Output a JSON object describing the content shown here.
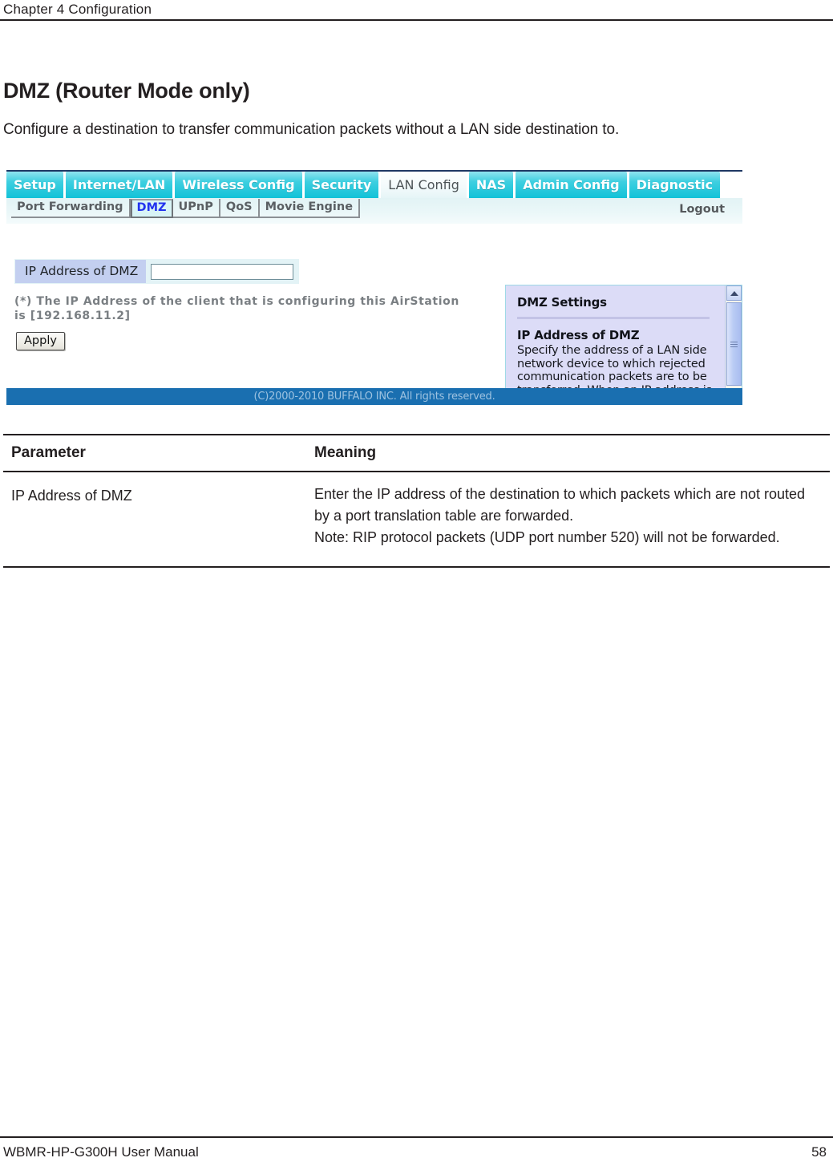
{
  "page": {
    "running_head": "Chapter 4  Configuration",
    "title": "DMZ (Router Mode only)",
    "subtitle": "Configure a destination to transfer communication packets without a LAN side destination to.",
    "footer_left": "WBMR-HP-G300H User Manual",
    "footer_page": "58"
  },
  "screenshot": {
    "tabs": [
      {
        "label": "Setup",
        "active": false
      },
      {
        "label": "Internet/LAN",
        "active": false
      },
      {
        "label": "Wireless Config",
        "active": false
      },
      {
        "label": "Security",
        "active": false
      },
      {
        "label": "LAN Config",
        "active": true
      },
      {
        "label": "NAS",
        "active": false
      },
      {
        "label": "Admin Config",
        "active": false
      },
      {
        "label": "Diagnostic",
        "active": false
      }
    ],
    "subtabs": [
      {
        "label": "Port Forwarding",
        "selected": false
      },
      {
        "label": "DMZ",
        "selected": true
      },
      {
        "label": "UPnP",
        "selected": false
      },
      {
        "label": "QoS",
        "selected": false
      },
      {
        "label": "Movie Engine",
        "selected": false
      }
    ],
    "logout_label": "Logout",
    "form": {
      "field_label": "IP Address of DMZ",
      "field_value": "",
      "field_placeholder": "",
      "note": "(*) The IP Address of the client that is configuring this AirStation is [192.168.11.2]",
      "apply_label": "Apply"
    },
    "help": {
      "heading": "DMZ Settings",
      "subheading": "IP Address of DMZ",
      "body": "Specify the address of a LAN side network device to which rejected communication packets are to be transferred. When an IP address is entered for the DMZ, it becomes possible to access the device at that address from outside the"
    },
    "footer": "(C)2000-2010 BUFFALO INC. All rights reserved.",
    "colors": {
      "tab_accent": "#12c2d8",
      "selected_subtab_text": "#2233ee",
      "footer_bar": "#1a6fb0",
      "field_label_bg": "#c3cff0",
      "help_bg": "#dcdcf7"
    }
  },
  "table": {
    "headers": [
      "Parameter",
      "Meaning"
    ],
    "rows": [
      {
        "parameter": "IP Address of DMZ",
        "meaning": "Enter the IP address of the destination to which packets which are not routed by a port translation table are forwarded.\nNote: RIP protocol packets (UDP port number 520) will not be forwarded."
      }
    ]
  }
}
